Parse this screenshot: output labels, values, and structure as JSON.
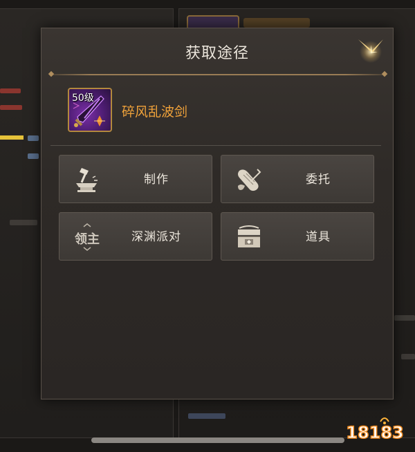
{
  "dialog": {
    "title": "获取途径",
    "item": {
      "level_badge": "50级",
      "name": "碎风乱波剑"
    },
    "sources": [
      {
        "label": "制作",
        "icon": "anvil-hammer-icon"
      },
      {
        "label": "委托",
        "icon": "scroll-icon"
      },
      {
        "label": "深渊派对",
        "icon": "lord-icon",
        "icon_text": "领主"
      },
      {
        "label": "道具",
        "icon": "treasure-chest-icon"
      }
    ]
  },
  "watermark": "18183",
  "colors": {
    "dialog_bg": "#2e2a27",
    "item_name": "#f0a23a",
    "close_star": "#f3c468",
    "button_bg": "#433e3a"
  }
}
